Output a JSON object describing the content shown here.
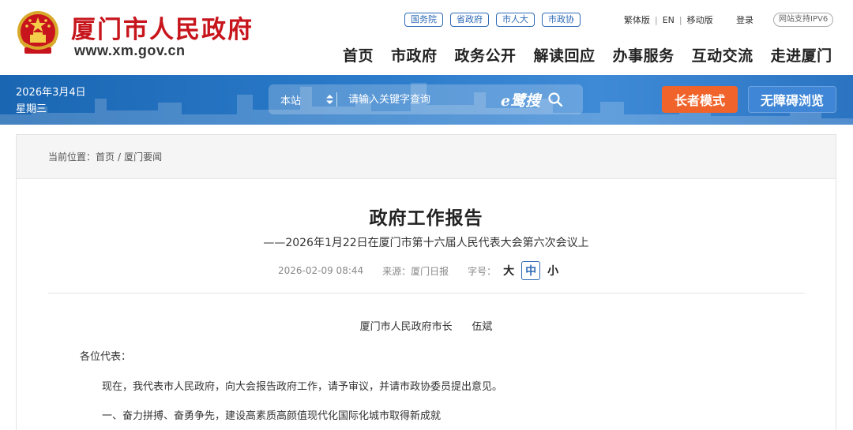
{
  "header": {
    "site_title": "厦门市人民政府",
    "site_url": "www.xm.gov.cn",
    "quick_links": [
      "国务院",
      "省政府",
      "市人大",
      "市政协"
    ],
    "utility": {
      "traditional": "繁体版",
      "english": "EN",
      "mobile": "移动版",
      "separator": "|",
      "login": "登录",
      "ipv6": "网站支持IPV6"
    },
    "nav": [
      "首页",
      "市政府",
      "政务公开",
      "解读回应",
      "办事服务",
      "互动交流",
      "走进厦门"
    ]
  },
  "bar": {
    "date": "2026年3月4日",
    "weekday": "星期三",
    "search": {
      "scope": "本站",
      "placeholder": "请输入关键字查询",
      "brand": "e鹭搜"
    },
    "elder_mode": "长者模式",
    "accessibility": "无障碍浏览"
  },
  "breadcrumb": {
    "prefix": "当前位置：",
    "home": "首页",
    "separator": "/",
    "current": "厦门要闻"
  },
  "article": {
    "title": "政府工作报告",
    "subtitle": "——2026年1月22日在厦门市第十六届人民代表大会第六次会议上",
    "date": "2026-02-09 08:44",
    "source": "来源：厦门日报",
    "font_label": "字号：",
    "font_sizes": [
      "大",
      "中",
      "小"
    ],
    "font_active": "中",
    "author": "厦门市人民政府市长      伍斌",
    "salutation": "各位代表：",
    "paragraphs": [
      "现在，我代表市人民政府，向大会报告政府工作，请予审议，并请市政协委员提出意见。",
      "一、奋力拼搏、奋勇争先，建设高素质高颜值现代化国际化城市取得新成就"
    ]
  },
  "colors": {
    "brand_red": "#c7151c",
    "bar_blue": "#2c7ccb",
    "link_blue": "#2e6bb6",
    "elder_orange": "#f0642b",
    "access_blue": "#3f86d6"
  },
  "icons": {
    "emblem": "national-emblem-icon",
    "search": "search-icon",
    "scope_arrows": "updown-arrows-icon"
  }
}
